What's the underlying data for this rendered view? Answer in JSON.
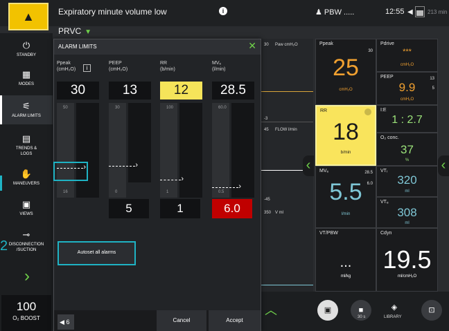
{
  "topbar": {
    "alarm_message": "Expiratory minute volume low",
    "info_glyph": "i",
    "pbw_label": "PBW .....",
    "clock": "12:55",
    "battery_time": "213 min"
  },
  "mode": {
    "name": "PRVC"
  },
  "sidebar": {
    "items": [
      {
        "label": "STANDBY",
        "icon": "power-icon",
        "glyph": "⏻"
      },
      {
        "label": "MODES",
        "icon": "grid-icon",
        "glyph": "▦"
      },
      {
        "label": "ALARM LIMITS",
        "icon": "alarm-limits-icon",
        "glyph": "⚟"
      },
      {
        "label": "TRENDS & LOGS",
        "icon": "trends-icon",
        "glyph": "▤"
      },
      {
        "label": "MANEUVERS",
        "icon": "maneuvers-icon",
        "glyph": "✋"
      },
      {
        "label": "VIEWS",
        "icon": "views-icon",
        "glyph": "▣"
      },
      {
        "label": "DISCONNECTION /SUCTION",
        "icon": "disconnection-icon",
        "glyph": "⊸"
      }
    ],
    "o2_value": "100",
    "o2_label": "O₂ BOOST"
  },
  "annotations": {
    "marker_1": "1",
    "marker_2": "2"
  },
  "dialog": {
    "title": "ALARM LIMITS",
    "columns": [
      {
        "name": "Ppeak",
        "unit": "(cmH₂O)",
        "upper": "30",
        "upper_tick": "50",
        "lower": "",
        "lower_tick": "16",
        "selected": false
      },
      {
        "name": "PEEP",
        "unit": "(cmH₂O)",
        "upper": "13",
        "upper_tick": "30",
        "lower": "5",
        "lower_tick": "0",
        "selected": false
      },
      {
        "name": "RR",
        "unit": "(b/min)",
        "upper": "12",
        "upper_tick": "100",
        "lower": "1",
        "lower_tick": "1",
        "selected": true
      },
      {
        "name": "MVₑ",
        "unit": "(l/min)",
        "upper": "28.5",
        "upper_tick": "60.0",
        "lower": "6.0",
        "lower_tick": "0.5",
        "selected": false
      }
    ],
    "autoset_label": "Autoset all alarms",
    "volume_level": "6",
    "cancel_label": "Cancel",
    "accept_label": "Accept"
  },
  "waveforms": {
    "paw_label": "Paw cmH₂O",
    "paw_max": "30",
    "paw_min": "-3",
    "flow_label": "FLOW l/min",
    "flow_max": "45",
    "flow_min": "-45",
    "vol_label": "V ml",
    "vol_max": "350"
  },
  "tiles": {
    "ppeak": {
      "name": "Ppeak",
      "value": "25",
      "unit": "cmH₂O",
      "limit": "30"
    },
    "pdrive": {
      "name": "Pdrive",
      "value": "***",
      "unit": "cmH₂O"
    },
    "peep": {
      "name": "PEEP",
      "value": "9.9",
      "unit": "cmH₂O",
      "limit_hi": "13",
      "limit_lo": "5"
    },
    "rr": {
      "name": "RR",
      "value": "18",
      "unit": "b/min"
    },
    "ie": {
      "name": "I:E",
      "value": "1 : 2.7"
    },
    "o2": {
      "name": "O₂ conc.",
      "value": "37",
      "unit": "%"
    },
    "mve": {
      "name": "MVₑ",
      "value": "5.5",
      "unit": "l/min",
      "limit_hi": "28.5",
      "limit_lo": "6.0"
    },
    "vti": {
      "name": "VTᵢ",
      "value": "320",
      "unit": "ml"
    },
    "vte": {
      "name": "VTₑ",
      "value": "308",
      "unit": "ml"
    },
    "vtpbw": {
      "name": "VT/PBW",
      "value": "...",
      "unit": "ml/kg"
    },
    "cdyn": {
      "name": "Cdyn",
      "value": "19.5",
      "unit": "ml/cmH₂O"
    }
  },
  "dock": {
    "camera_label": "",
    "rec_label": "30 s",
    "library_label": "LIBRARY"
  },
  "colors": {
    "accent_green": "#6fd14a",
    "alarm_yellow": "#f2c200",
    "alarm_red": "#c00000",
    "highlight_cyan": "#1fb3c4",
    "value_orange": "#f0a030",
    "value_teal": "#7fc7d6"
  }
}
